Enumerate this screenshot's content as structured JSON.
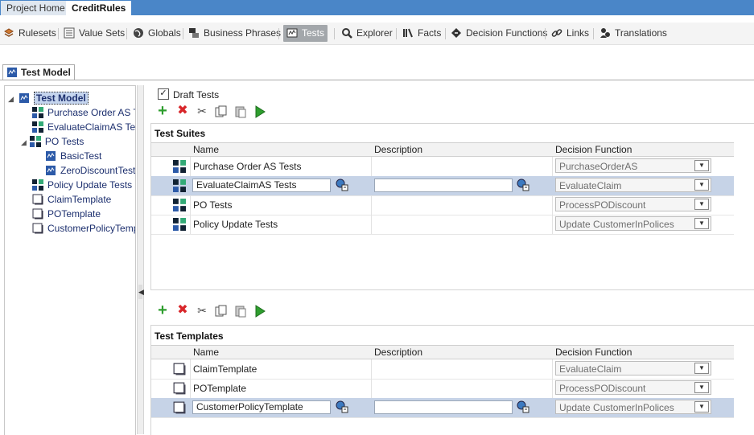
{
  "top_tabs": [
    "Project Home",
    "CreditRules"
  ],
  "toolbar": [
    {
      "label": "Rulesets",
      "icon": "rulesets-icon"
    },
    {
      "label": "Value Sets",
      "icon": "value-sets-icon"
    },
    {
      "label": "Globals",
      "icon": "globe-icon"
    },
    {
      "label": "Business Phrases",
      "icon": "business-phrases-icon"
    },
    {
      "label": "Tests",
      "icon": "tests-icon",
      "selected": true
    },
    {
      "label": "Explorer",
      "icon": "search-icon"
    },
    {
      "label": "Facts",
      "icon": "facts-icon"
    },
    {
      "label": "Decision Functions",
      "icon": "decision-functions-icon"
    },
    {
      "label": "Links",
      "icon": "link-icon"
    },
    {
      "label": "Translations",
      "icon": "translations-icon"
    }
  ],
  "model_tab": "Test Model",
  "tree": {
    "root": "Test Model",
    "items": [
      "Purchase Order AS T",
      "EvaluateClaimAS Tes",
      "PO Tests",
      "BasicTest",
      "ZeroDiscountTest",
      "Policy Update Tests",
      "ClaimTemplate",
      "POTemplate",
      "CustomerPolicyTemp"
    ]
  },
  "draft_tests_label": "Draft Tests",
  "columns": {
    "name": "Name",
    "description": "Description",
    "decision_function": "Decision Function"
  },
  "suites": {
    "title": "Test Suites",
    "rows": [
      {
        "name": "Purchase Order AS Tests",
        "description": "",
        "function": "PurchaseOrderAS"
      },
      {
        "name": "EvaluateClaimAS Tests",
        "description": "",
        "function": "EvaluateClaim"
      },
      {
        "name": "PO Tests",
        "description": "",
        "function": "ProcessPODiscount"
      },
      {
        "name": "Policy Update Tests",
        "description": "",
        "function": "Update CustomerInPolices"
      }
    ]
  },
  "templates": {
    "title": "Test Templates",
    "rows": [
      {
        "name": "ClaimTemplate",
        "description": "",
        "function": "EvaluateClaim"
      },
      {
        "name": "POTemplate",
        "description": "",
        "function": "ProcessPODiscount"
      },
      {
        "name": "CustomerPolicyTemplate",
        "description": "",
        "function": "Update CustomerInPolices"
      }
    ]
  },
  "colors": {
    "header_blue": "#4a86c8",
    "selection": "#c6d3e7",
    "add_green": "#2e9e2e",
    "delete_red": "#d8262a"
  }
}
